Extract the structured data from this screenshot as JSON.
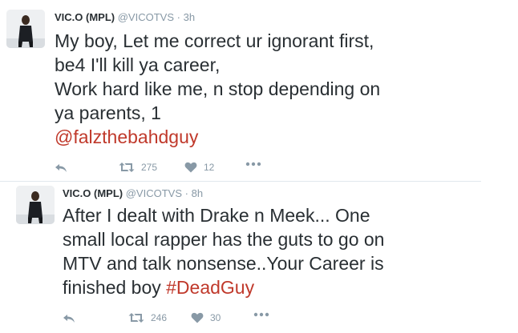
{
  "tweets": [
    {
      "name": "VIC.O (MPL)",
      "handle": "@VICOTVS",
      "separator": "·",
      "time": "3h",
      "lines": [
        "My boy, Let me correct ur ignorant first,",
        "be4 I'll kill ya career,",
        "Work hard like me, n stop depending on",
        "ya parents, 1"
      ],
      "mention": "@falzthebahdguy",
      "retweets": "275",
      "likes": "12",
      "icons": [
        "reply-icon",
        "retweet-icon",
        "heart-icon",
        "more-icon"
      ]
    },
    {
      "name": "VIC.O (MPL)",
      "handle": "@VICOTVS",
      "separator": "·",
      "time": "8h",
      "lines": [
        "After I dealt with Drake n Meek... One",
        "small local rapper has the guts to go on",
        "MTV and talk nonsense..Your Career is",
        "finished boy "
      ],
      "hashtag": "#DeadGuy",
      "retweets": "246",
      "likes": "30",
      "icons": [
        "reply-icon",
        "retweet-icon",
        "heart-icon",
        "more-icon"
      ]
    }
  ],
  "colors": {
    "text": "#292f33",
    "muted": "#8899a6",
    "link": "#c0392b",
    "divider": "#e1e8ed"
  }
}
